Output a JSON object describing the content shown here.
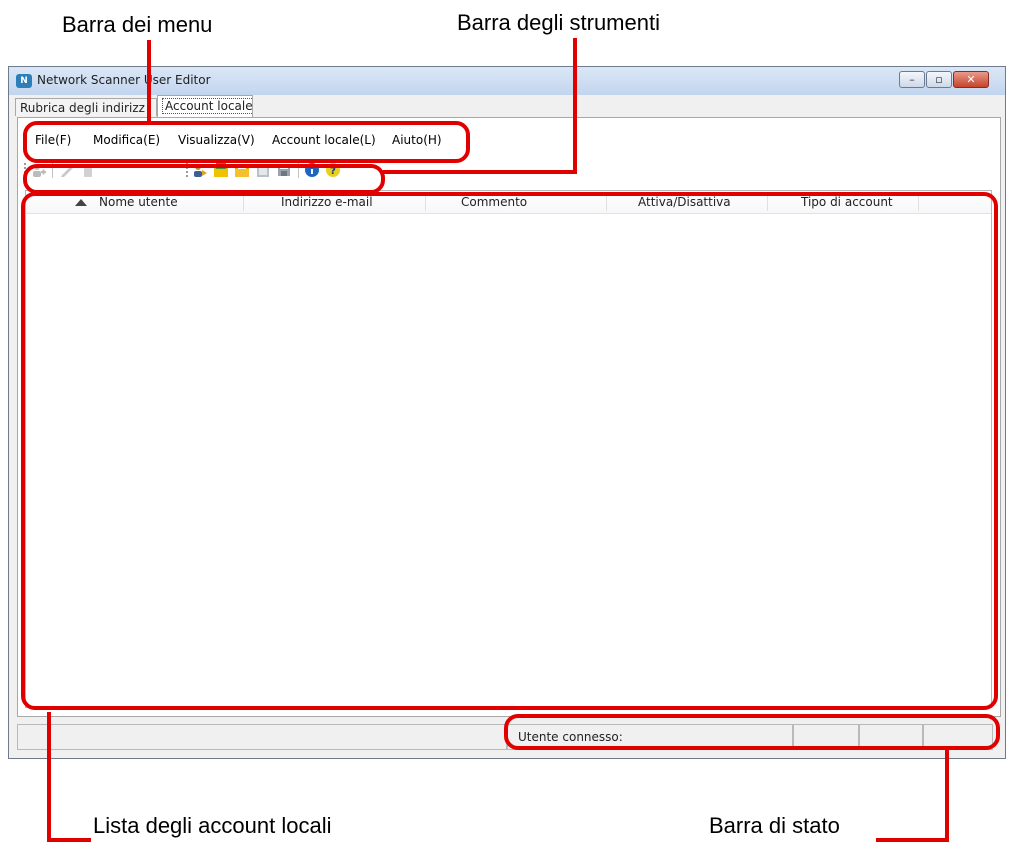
{
  "callouts": {
    "menu_bar": "Barra dei menu",
    "toolbar": "Barra degli strumenti",
    "account_list": "Lista degli account locali",
    "status_bar": "Barra di stato"
  },
  "window": {
    "title": "Network Scanner User Editor",
    "icon": "app-logo-icon",
    "controls": {
      "minimize": "minimize-icon",
      "maximize": "maximize-icon",
      "close": "close-icon"
    }
  },
  "tabs": [
    {
      "label": "Rubrica degli indirizz",
      "active": false
    },
    {
      "label": "Account locale",
      "active": true
    }
  ],
  "menu": [
    "File(F)",
    "Modifica(E)",
    "Visualizza(V)",
    "Account locale(L)",
    "Aiuto(H)"
  ],
  "toolbar": {
    "icons": [
      {
        "name": "add-user-icon",
        "enabled": false
      },
      {
        "name": "edit-icon",
        "enabled": false
      },
      {
        "name": "delete-icon",
        "enabled": false
      },
      {
        "name": "import-user-icon",
        "enabled": true
      },
      {
        "name": "open-folder-green-icon",
        "enabled": true
      },
      {
        "name": "open-folder-orange-icon",
        "enabled": true
      },
      {
        "name": "export-icon",
        "enabled": true
      },
      {
        "name": "save-icon",
        "enabled": true
      },
      {
        "name": "info-icon",
        "enabled": true
      },
      {
        "name": "help-icon",
        "enabled": true
      }
    ]
  },
  "list": {
    "sort_icon": "sort-ascending-icon",
    "columns": [
      "Nome utente",
      "Indirizzo e-mail",
      "Commento",
      "Attiva/Disattiva",
      "Tipo di account"
    ],
    "rows": []
  },
  "status": {
    "connected_user": "Utente connesso:"
  },
  "colors": {
    "annotation": "#e00000",
    "window_bg": "#f0f0f0"
  }
}
